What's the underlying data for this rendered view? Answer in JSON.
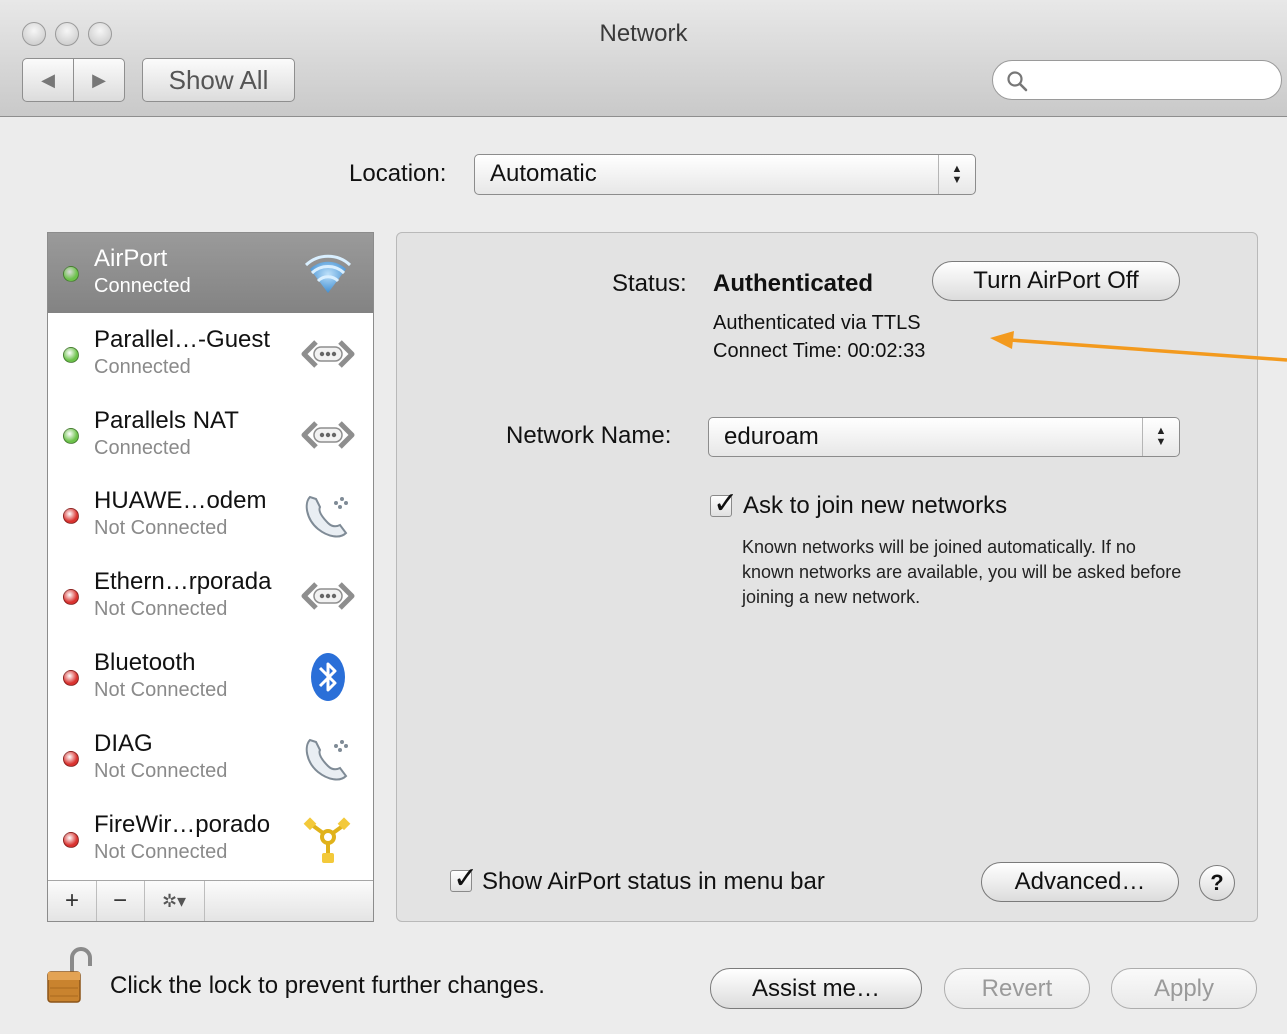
{
  "window": {
    "title": "Network"
  },
  "toolbar": {
    "back_icon": "◀",
    "forward_icon": "▶",
    "show_all": "Show All",
    "search_placeholder": ""
  },
  "location": {
    "label": "Location:",
    "value": "Automatic"
  },
  "services": [
    {
      "name": "AirPort",
      "status": "Connected",
      "dot": "#6cc24a",
      "icon": "wifi-icon",
      "selected": true
    },
    {
      "name": "Parallel…-Guest",
      "status": "Connected",
      "dot": "#6cc24a",
      "icon": "ethernet-icon"
    },
    {
      "name": "Parallels NAT",
      "status": "Connected",
      "dot": "#6cc24a",
      "icon": "ethernet-icon"
    },
    {
      "name": "HUAWE…odem",
      "status": "Not Connected",
      "dot": "#d9322f",
      "icon": "modem-phone-icon"
    },
    {
      "name": "Ethern…rporada",
      "status": "Not Connected",
      "dot": "#d9322f",
      "icon": "ethernet-icon"
    },
    {
      "name": "Bluetooth",
      "status": "Not Connected",
      "dot": "#d9322f",
      "icon": "bluetooth-icon"
    },
    {
      "name": "DIAG",
      "status": "Not Connected",
      "dot": "#d9322f",
      "icon": "modem-phone-icon"
    },
    {
      "name": "FireWir…porado",
      "status": "Not Connected",
      "dot": "#d9322f",
      "icon": "firewire-icon"
    }
  ],
  "list_toolbar": {
    "add": "+",
    "remove": "−",
    "action": "✲▾"
  },
  "detail": {
    "status_label": "Status:",
    "status_value": "Authenticated",
    "turn_off_button": "Turn AirPort Off",
    "auth_line": "Authenticated via TTLS",
    "connect_time": "Connect Time: 00:02:33",
    "network_name_label": "Network Name:",
    "network_name_value": "eduroam",
    "ask_join_label": "Ask to join new networks",
    "ask_join_checked": true,
    "ask_join_help": "Known networks will be joined automatically. If no known networks are available, you will be asked before joining a new network.",
    "menubar_label": "Show AirPort status in menu bar",
    "menubar_checked": true,
    "advanced_button": "Advanced…",
    "help_button": "?"
  },
  "footer": {
    "lock_text": "Click the lock to prevent further changes.",
    "assist_button": "Assist me…",
    "revert_button": "Revert",
    "apply_button": "Apply"
  },
  "colors": {
    "annotation_arrow": "#f39a1e",
    "selected_row": "#8d8d8d"
  }
}
